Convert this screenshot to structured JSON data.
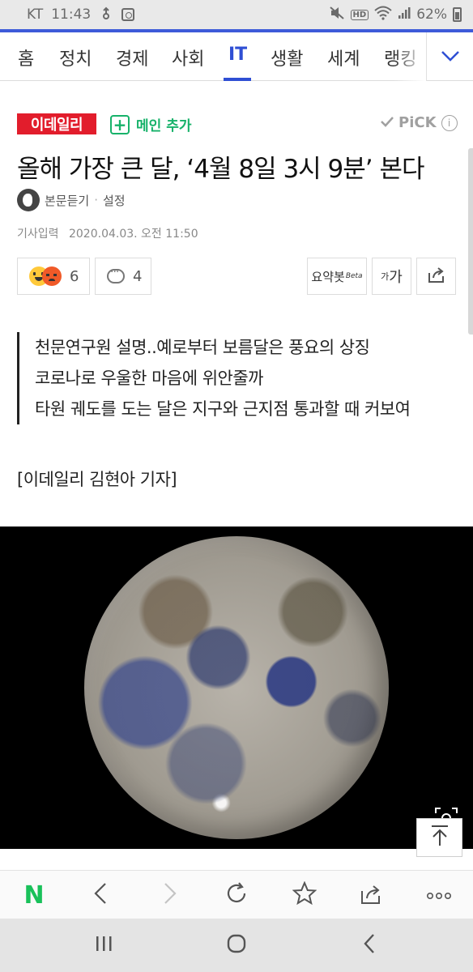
{
  "status_bar": {
    "carrier": "KT",
    "time": "11:43",
    "battery": "62%",
    "icons": [
      "usb-icon",
      "screen-record-icon",
      "mute-icon",
      "hd-icon",
      "wifi-icon",
      "signal-icon",
      "battery-icon"
    ]
  },
  "category_nav": {
    "items": [
      "홈",
      "정치",
      "경제",
      "사회",
      "IT",
      "생활",
      "세계",
      "랭킹"
    ],
    "active": "IT",
    "more_icon": "chevron-down-icon"
  },
  "article": {
    "press_name": "이데일리",
    "add_main_label": "메인 추가",
    "pick_label": "PiCK",
    "pick_info_symbol": "i",
    "headline": "올해 가장 큰 달, ‘4월 8일 3시 9분’ 본다",
    "listen_label": "본문듣기",
    "listen_separator": "·",
    "settings_label": "설정",
    "date_label": "기사입력",
    "date_value": "2020.04.03. 오전 11:50",
    "reaction_count": "6",
    "comment_count": "4",
    "summary_bot_label": "요약봇",
    "summary_bot_beta": "Beta",
    "font_size_small": "가",
    "font_size_large": "가",
    "summary_lines": [
      "천문연구원 설명..예로부터 보름달은 풍요의 상징",
      "코로나로 우울한 마음에 위안줄까",
      "타원 궤도를 도는 달은 지구와 근지점 통과할 때 커보여"
    ],
    "byline": "[이데일리 김현아 기자]",
    "photo_subject": "full-moon-photo"
  },
  "browser_toolbar": {
    "home_label": "N",
    "buttons": [
      "back-icon",
      "forward-icon",
      "refresh-icon",
      "bookmark-icon",
      "share-icon",
      "more-icon"
    ]
  },
  "android_nav": {
    "buttons": [
      "recent-apps-icon",
      "home-icon",
      "back-icon"
    ]
  },
  "colors": {
    "accent_blue": "#2f4fd4",
    "press_red": "#e21d2c",
    "naver_green": "#19c15a"
  }
}
